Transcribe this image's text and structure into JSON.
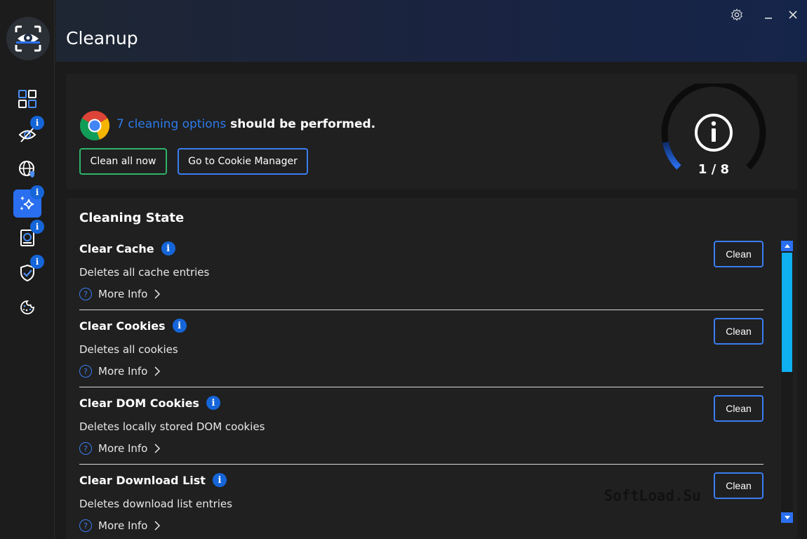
{
  "app": {
    "title": "Cleanup"
  },
  "colors": {
    "accent": "#2a6ff0",
    "highlight": "#2d7bea",
    "success": "#2fb36a",
    "badge": "#1565d8",
    "scroll_thumb": "#0fb0f0"
  },
  "sidebar": {
    "items": [
      {
        "icon": "dashboard-icon",
        "badge": ""
      },
      {
        "icon": "eye-tracking-icon",
        "badge": "i"
      },
      {
        "icon": "globe-shield-icon",
        "badge": ""
      },
      {
        "icon": "sparkle-cleanup-icon",
        "badge": "i",
        "active": true
      },
      {
        "icon": "storage-icon",
        "badge": "i"
      },
      {
        "icon": "shield-check-icon",
        "badge": "i"
      },
      {
        "icon": "cookie-icon",
        "badge": ""
      }
    ]
  },
  "summary": {
    "count_text": "7 cleaning options",
    "rest_text": " should be performed.",
    "clean_all_label": "Clean all now",
    "cookie_manager_label": "Go to Cookie Manager",
    "gauge_count": "1 / 8",
    "gauge_progress": 0.125
  },
  "state": {
    "title": "Cleaning State",
    "info_badge": "i",
    "more_info_label": "More Info",
    "clean_label": "Clean",
    "items": [
      {
        "title": "Clear Cache",
        "desc": "Deletes all cache entries"
      },
      {
        "title": "Clear Cookies",
        "desc": "Deletes all cookies"
      },
      {
        "title": "Clear DOM Cookies",
        "desc": "Deletes locally stored DOM cookies"
      },
      {
        "title": "Clear Download List",
        "desc": "Deletes download list entries"
      }
    ]
  },
  "watermark": "SoftLoad.Su"
}
